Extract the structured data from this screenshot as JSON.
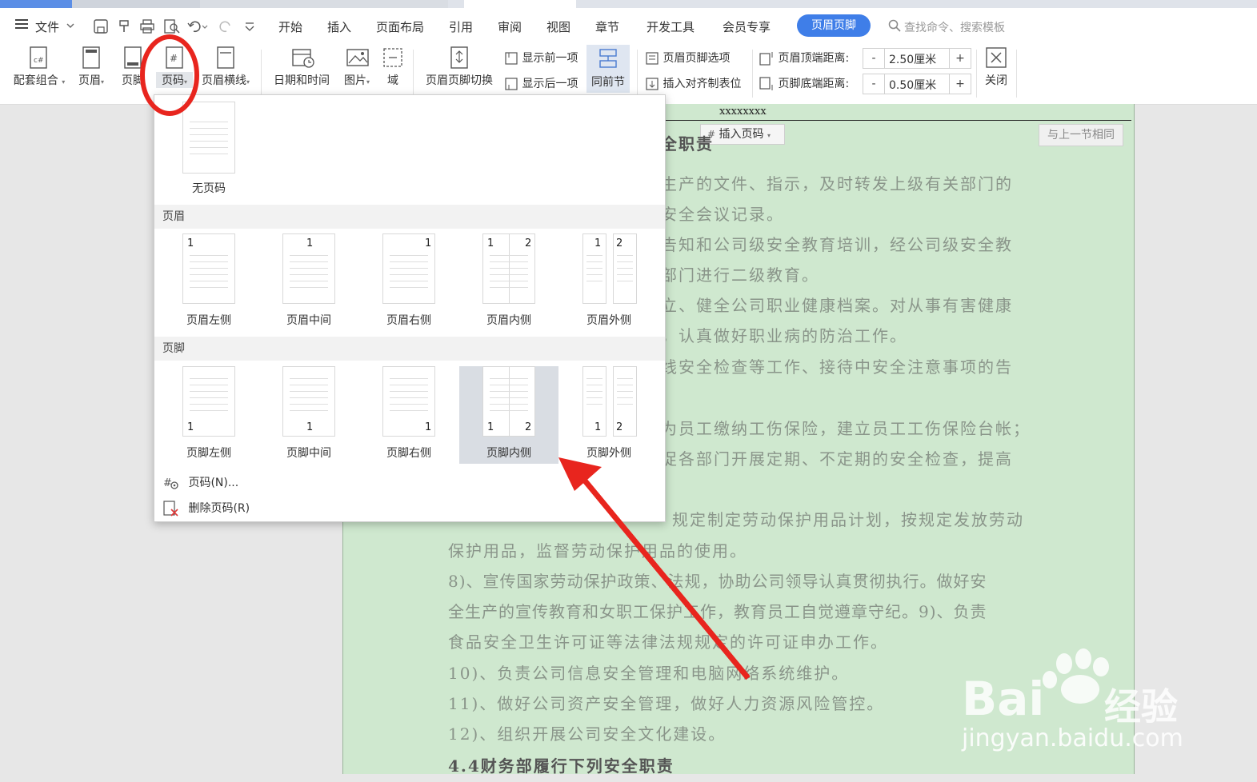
{
  "menubar": {
    "file": "文件",
    "tabs": [
      "开始",
      "插入",
      "页面布局",
      "引用",
      "审阅",
      "视图",
      "章节",
      "开发工具",
      "会员专享"
    ],
    "active_tab": "页眉页脚",
    "search": "查找命令、搜索模板"
  },
  "ribbon": {
    "combo": "配套组合",
    "header": "页眉",
    "footer": "页脚",
    "page_number": "页码",
    "header_line": "页眉横线",
    "datetime": "日期和时间",
    "picture": "图片",
    "field": "域",
    "switch": "页眉页脚切换",
    "show_prev": "显示前一项",
    "show_next": "显示后一项",
    "same_as_prev": "同前节",
    "options": "页眉页脚选项",
    "insert_align_tab": "插入对齐制表位",
    "header_top_label": "页眉顶端距离:",
    "header_top_value": "2.50厘米",
    "footer_bottom_label": "页脚底端距离:",
    "footer_bottom_value": "0.50厘米",
    "close": "关闭",
    "minus": "-",
    "plus": "+"
  },
  "dropdown": {
    "none": "无页码",
    "section_header": "页眉",
    "section_footer": "页脚",
    "header_items": [
      "页眉左侧",
      "页眉中间",
      "页眉右侧",
      "页眉内侧",
      "页眉外侧"
    ],
    "footer_items": [
      "页脚左侧",
      "页脚中间",
      "页脚右侧",
      "页脚内侧",
      "页脚外侧"
    ],
    "num1": "1",
    "num2": "2",
    "page_num_menu": "页码(N)...",
    "delete_menu": "删除页码(R)"
  },
  "document": {
    "header_text": "xxxxxxxx",
    "insert_page_number": "插入页码",
    "same_as_prev_section": "与上一节相同",
    "lines": [
      "全职责",
      "生产的文件、指示，及时转发上级有关部门的",
      "安全会议记录。",
      "告知和公司级安全教育培训，经公司级安全教",
      "部门进行二级教育。",
      "立、健全公司职业健康档案。对从事有害健康",
      "，认真做好职业病的防治工作。",
      "线安全检查等工作、接待中安全注意事项的告",
      "为员工缴纳工伤保险，建立员工工伤保险台帐；",
      "促各部门开展定期、不定期的安全检查，提高",
      "规定制定劳动保护用品计划，按规定发放劳动",
      "保护用品，监督劳动保护用品的使用。",
      "8)、宣传国家劳动保护政策、法规，协助公司领导认真贯彻执行。做好安",
      "全生产的宣传教育和女职工保护工作，教育员工自觉遵章守纪。9)、负责",
      "食品安全卫生许可证等法律法规规定的许可证申办工作。",
      "10)、负责公司信息安全管理和电脑网络系统维护。",
      "11)、做好公司资产安全管理，做好人力资源风险管控。",
      "12)、组织开展公司安全文化建设。",
      "4.4财务部履行下列安全职责"
    ]
  },
  "watermark": {
    "brand": "Bai",
    "brand2": "经验",
    "url": "jingyan.baidu.com"
  },
  "colors": {
    "accent": "#3f7ee8",
    "annotation": "#e8251e",
    "page_bg": "#cfe8cf"
  }
}
